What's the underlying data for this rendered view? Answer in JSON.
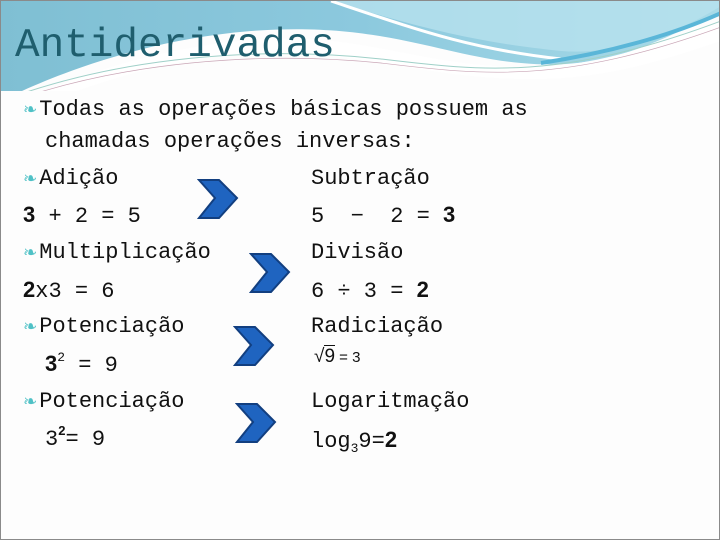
{
  "title": "Antiderivadas",
  "intro": {
    "line1": "Todas as operações básicas possuem as",
    "line2": "chamadas operações inversas:"
  },
  "rows": [
    {
      "left_label": "Adição",
      "left_expr": {
        "a": "3",
        "rest": " + 2 = 5"
      },
      "right_label": "Subtração",
      "right_expr": {
        "rest": "5  −  2 = ",
        "result": "3"
      }
    },
    {
      "left_label": "Multiplicação",
      "left_expr": {
        "a": "2",
        "rest": "x3 = 6"
      },
      "right_label": "Divisão",
      "right_expr": {
        "rest": "6 ÷ 3 = ",
        "result": "2"
      }
    },
    {
      "left_label": "Potenciação",
      "left_expr": {
        "base": "3",
        "exp": "2",
        "rest": " = 9"
      },
      "right_label": "Radiciação",
      "right_expr": {
        "radical": "√",
        "radicand": "9",
        "rest": " = 3"
      }
    },
    {
      "left_label": "Potenciação",
      "left_expr": {
        "base": "3",
        "exp": "2",
        "rest": "= 9"
      },
      "right_label": "Logaritmação",
      "right_expr": {
        "log": "log",
        "sub": "3",
        "arg": "9=",
        "result": "2"
      }
    }
  ],
  "bullet_icon": "curl-bullet-icon",
  "arrow_icon": "chevron-right-icon",
  "colors": {
    "title": "#1f5e6e",
    "bullet": "#4fc1c6",
    "arrow": "#1f64c0",
    "arrow_edge": "#123f80"
  }
}
